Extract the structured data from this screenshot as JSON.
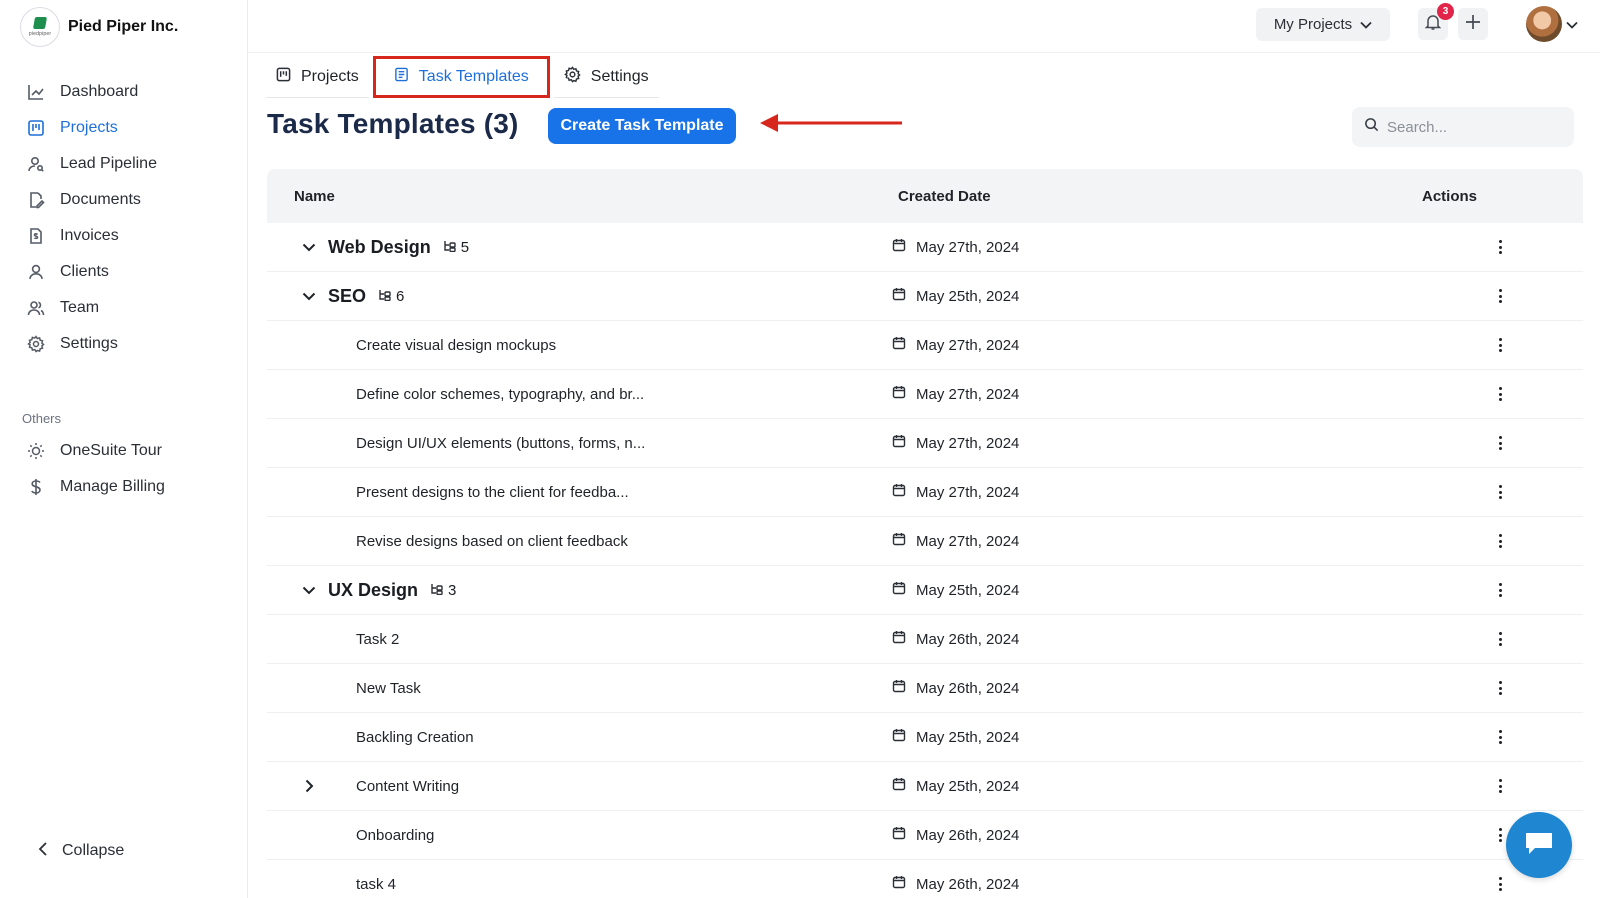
{
  "brand": {
    "name": "Pied Piper Inc.",
    "logo_text": "piedpiper"
  },
  "sidebar": {
    "items": [
      {
        "label": "Dashboard",
        "icon": "chart-line-icon"
      },
      {
        "label": "Projects",
        "icon": "kanban-icon",
        "active": true
      },
      {
        "label": "Lead Pipeline",
        "icon": "user-search-icon"
      },
      {
        "label": "Documents",
        "icon": "document-edit-icon"
      },
      {
        "label": "Invoices",
        "icon": "invoice-icon"
      },
      {
        "label": "Clients",
        "icon": "user-icon"
      },
      {
        "label": "Team",
        "icon": "team-icon"
      },
      {
        "label": "Settings",
        "icon": "gear-icon"
      }
    ],
    "others_label": "Others",
    "others": [
      {
        "label": "OneSuite Tour",
        "icon": "sun-icon"
      },
      {
        "label": "Manage Billing",
        "icon": "dollar-icon"
      }
    ],
    "collapse_label": "Collapse"
  },
  "topbar": {
    "project_selector": "My Projects",
    "notification_count": "3"
  },
  "tabs": [
    {
      "label": "Projects"
    },
    {
      "label": "Task Templates",
      "active": true
    },
    {
      "label": "Settings"
    }
  ],
  "page": {
    "title": "Task Templates (3)",
    "create_button": "Create Task Template",
    "search_placeholder": "Search..."
  },
  "table": {
    "headers": {
      "name": "Name",
      "date": "Created Date",
      "actions": "Actions"
    },
    "rows": [
      {
        "type": "group",
        "name": "Web Design",
        "count": "5",
        "date": "May 27th, 2024",
        "expanded": true
      },
      {
        "type": "group",
        "name": "SEO",
        "count": "6",
        "date": "May 25th, 2024",
        "expanded": true
      },
      {
        "type": "child",
        "name": "Create visual design mockups",
        "date": "May 27th, 2024"
      },
      {
        "type": "child",
        "name": "Define color schemes, typography, and br...",
        "date": "May 27th, 2024"
      },
      {
        "type": "child",
        "name": "Design UI/UX elements (buttons, forms, n...",
        "date": "May 27th, 2024"
      },
      {
        "type": "child",
        "name": "Present designs to the client for feedba...",
        "date": "May 27th, 2024"
      },
      {
        "type": "child",
        "name": "Revise designs based on client feedback",
        "date": "May 27th, 2024"
      },
      {
        "type": "group",
        "name": "UX Design",
        "count": "3",
        "date": "May 25th, 2024",
        "expanded": true
      },
      {
        "type": "child",
        "name": "Task 2",
        "date": "May 26th, 2024"
      },
      {
        "type": "child",
        "name": "New Task",
        "date": "May 26th, 2024"
      },
      {
        "type": "child",
        "name": "Backling Creation",
        "date": "May 25th, 2024"
      },
      {
        "type": "subgroup",
        "name": "Content Writing",
        "date": "May 25th, 2024",
        "expanded": false
      },
      {
        "type": "child",
        "name": "Onboarding",
        "date": "May 26th, 2024"
      },
      {
        "type": "child",
        "name": "task 4",
        "date": "May 26th, 2024"
      }
    ]
  },
  "colors": {
    "accent": "#1872e8",
    "highlight_box": "#d7261c",
    "badge": "#e2234a",
    "chat": "#1f86d1"
  }
}
